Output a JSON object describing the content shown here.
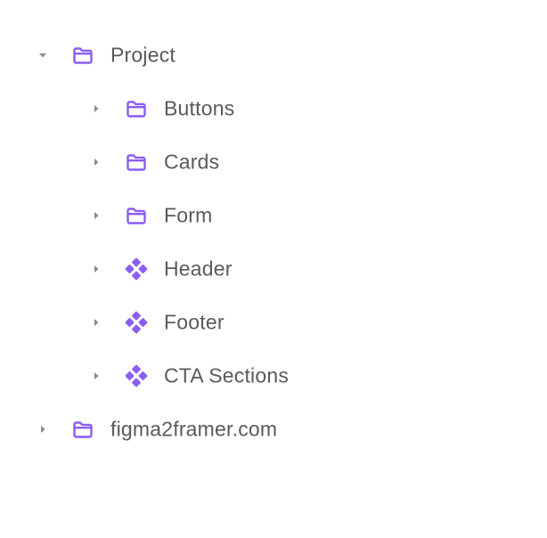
{
  "tree": {
    "accent_color": "#8b5cf6",
    "chevron_color": "#8a8a8a",
    "items": [
      {
        "label": "Project",
        "icon": "folder-icon",
        "expanded": true,
        "level": 0
      },
      {
        "label": "Buttons",
        "icon": "folder-icon",
        "expanded": false,
        "level": 1
      },
      {
        "label": "Cards",
        "icon": "folder-icon",
        "expanded": false,
        "level": 1
      },
      {
        "label": "Form",
        "icon": "folder-icon",
        "expanded": false,
        "level": 1
      },
      {
        "label": "Header",
        "icon": "component-icon",
        "expanded": false,
        "level": 1
      },
      {
        "label": "Footer",
        "icon": "component-icon",
        "expanded": false,
        "level": 1
      },
      {
        "label": "CTA Sections",
        "icon": "component-icon",
        "expanded": false,
        "level": 1
      },
      {
        "label": "figma2framer.com",
        "icon": "folder-icon",
        "expanded": false,
        "level": 0
      }
    ]
  }
}
